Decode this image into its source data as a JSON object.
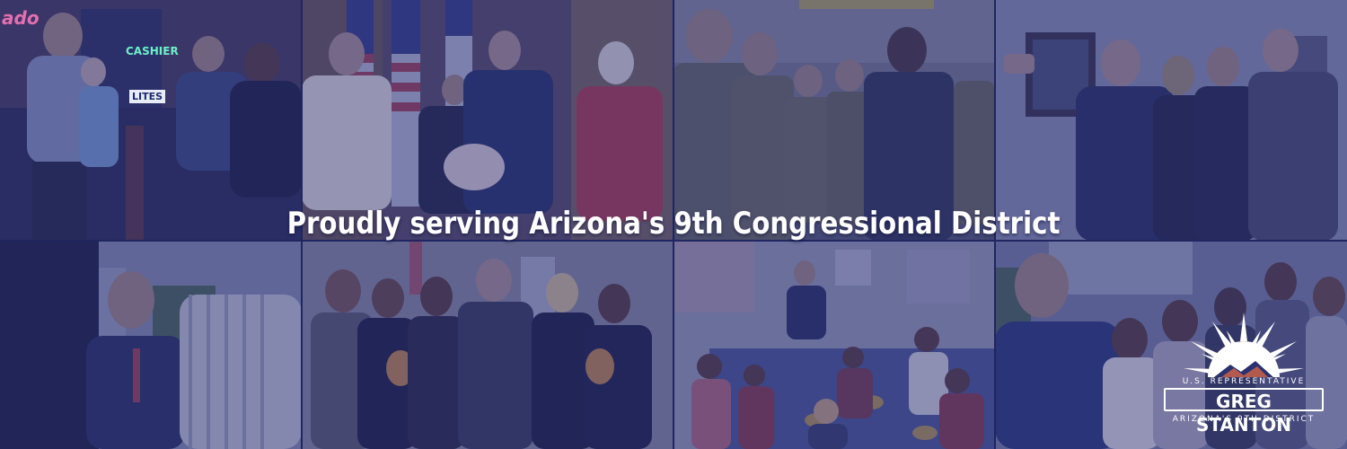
{
  "banner": {
    "headline": "Proudly serving Arizona's 9th Congressional District",
    "signs": {
      "cashier": "CASHIER",
      "lites": "LITES",
      "ado": "ado"
    },
    "logo": {
      "line1": "U.S. REPRESENTATIVE",
      "line2": "GREG STANTON",
      "line3": "ARIZONA'S 9TH DISTRICT"
    },
    "colors": {
      "overlay": "#2a3170",
      "text": "#ffffff"
    }
  }
}
